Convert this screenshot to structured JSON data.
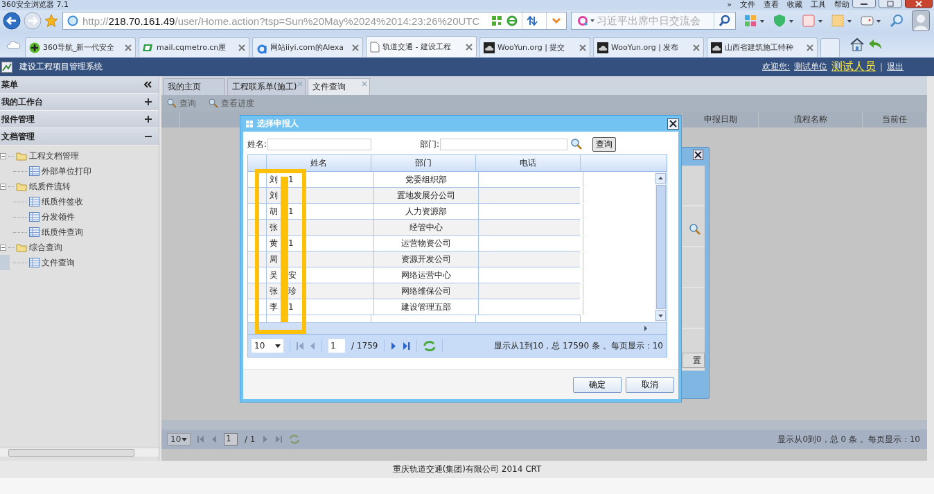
{
  "browser": {
    "title": "360安全浏览器 7.1",
    "menu": [
      "»",
      "文件",
      "查看",
      "收藏",
      "工具",
      "帮助"
    ],
    "address": {
      "scheme": "http://",
      "host": "218.70.161.49",
      "path": "/user/Home.action?tsp=Sun%20May%2024%2014:23:26%20UTC"
    },
    "search": {
      "placeholder": "习近平出席中日交流会"
    },
    "tabs": [
      {
        "label": "360导航_新一代安全",
        "kind": "plus",
        "selected": false
      },
      {
        "label": "mail.cqmetro.cn厘",
        "kind": "mail",
        "selected": false
      },
      {
        "label": "网站iiyi.com的Alexa",
        "kind": "letter",
        "selected": false
      },
      {
        "label": "轨道交通 - 建设工程",
        "kind": "page",
        "selected": true
      },
      {
        "label": "WooYun.org | 提交",
        "kind": "cloud",
        "selected": false
      },
      {
        "label": "WooYun.org | 发布",
        "kind": "cloud",
        "selected": false
      },
      {
        "label": "山西省建筑施工特种",
        "kind": "cloud",
        "selected": false
      }
    ]
  },
  "app": {
    "title": "建设工程项目管理系统",
    "welcome": "欢迎您:",
    "unit": "测试单位",
    "user": "测试人员",
    "separator": "|",
    "logout": "退出"
  },
  "sidebar": {
    "title": "菜单",
    "sections": [
      {
        "label": "我的工作台",
        "expanded": false
      },
      {
        "label": "报件管理",
        "expanded": false
      },
      {
        "label": "文档管理",
        "expanded": true
      }
    ],
    "tree": [
      {
        "label": "工程文档管理",
        "kind": "folder",
        "expanded": true,
        "children": [
          {
            "label": "外部单位打印",
            "kind": "page",
            "selected": false
          }
        ]
      },
      {
        "label": "纸质件流转",
        "kind": "folder",
        "expanded": true,
        "children": [
          {
            "label": "纸质件签收",
            "kind": "page",
            "selected": false
          },
          {
            "label": "分发领件",
            "kind": "page",
            "selected": false
          },
          {
            "label": "纸质件查询",
            "kind": "page",
            "selected": false
          }
        ]
      },
      {
        "label": "综合查询",
        "kind": "folder",
        "expanded": true,
        "children": [
          {
            "label": "文件查询",
            "kind": "page",
            "selected": true
          }
        ]
      }
    ]
  },
  "main": {
    "tabs": [
      {
        "label": "我的主页",
        "selected": false,
        "closable": false
      },
      {
        "label": "工程联系单(施工)",
        "selected": false,
        "closable": true
      },
      {
        "label": "文件查询",
        "selected": true,
        "closable": true
      }
    ],
    "toolbar": [
      "查询",
      "查看进度"
    ],
    "columns": [
      "申报日期",
      "流程名称",
      "当前任"
    ],
    "pager": {
      "page_size": "10",
      "page": "1",
      "total": "/ 1",
      "info": "显示从0到0，总 0 条 。每页显示：10"
    }
  },
  "back_dialog": {
    "button": "置"
  },
  "dialog": {
    "title": "选择申报人",
    "fields": [
      {
        "label": "姓名:"
      },
      {
        "label": "部门:"
      }
    ],
    "search_button": "查询",
    "columns": [
      "姓名",
      "部门",
      "电话"
    ],
    "rows": [
      {
        "name_head": "刘",
        "name_tail": "1",
        "dept": "党委组织部"
      },
      {
        "name_head": "刘",
        "dept": "置地发展分公司"
      },
      {
        "name_head": "胡",
        "name_tail": "1",
        "dept": "人力资源部"
      },
      {
        "name_head": "张",
        "dept": "经管中心"
      },
      {
        "name_head": "黄",
        "name_tail": "1",
        "dept": "运营物资公司"
      },
      {
        "name_head": "周",
        "dept": "资源开发公司"
      },
      {
        "name_head": "吴",
        "name_tail": "安",
        "dept": "网络运营中心"
      },
      {
        "name_head": "张",
        "name_tail": "珍",
        "dept": "网络维保公司"
      },
      {
        "name_head": "李",
        "name_tail": "1",
        "dept": "建设管理五部"
      }
    ],
    "pager": {
      "page_size": "10",
      "page": "1",
      "total": "/ 1759",
      "info": "显示从1到10，总 17590 条 。每页显示：10"
    },
    "buttons": [
      "确定",
      "取消"
    ]
  },
  "footer": "重庆轨道交通(集团)有限公司 2014 CRT"
}
